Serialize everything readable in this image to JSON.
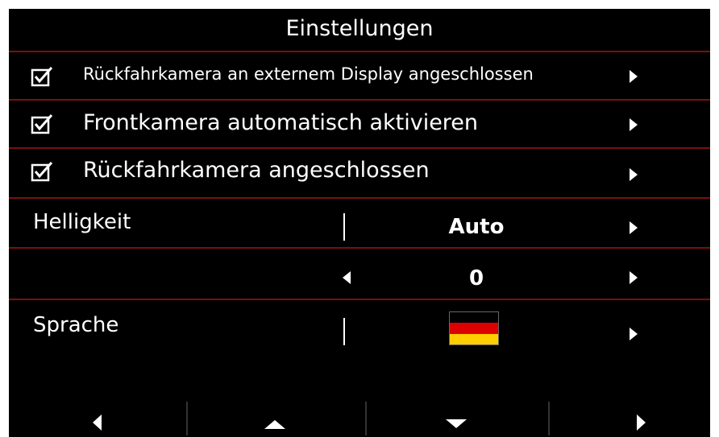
{
  "title": "Einstellungen",
  "checkbox_items": [
    {
      "label": "Rückfahrkamera an externem Display angeschlossen",
      "checked": true
    },
    {
      "label": "Frontkamera automatisch aktivieren",
      "checked": true
    },
    {
      "label": "Rückfahrkamera angeschlossen",
      "checked": true
    }
  ],
  "brightness": {
    "label": "Helligkeit",
    "mode": "Auto",
    "level": "0"
  },
  "language": {
    "label": "Sprache",
    "flag": "germany-flag",
    "flag_colors": [
      "#000000",
      "#dd0000",
      "#ffce00"
    ]
  },
  "colors": {
    "background": "#000000",
    "separator": "#7a1010",
    "text": "#ffffff"
  },
  "nav_icons": [
    "left-arrow-icon",
    "up-arrow-icon",
    "down-arrow-icon",
    "right-arrow-icon"
  ]
}
